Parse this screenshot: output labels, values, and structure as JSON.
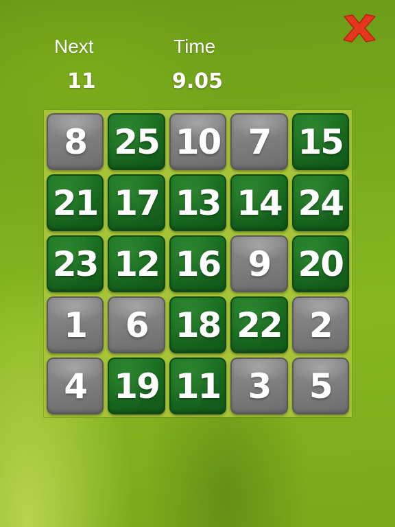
{
  "header": {
    "next_label": "Next",
    "next_value": "11",
    "time_label": "Time",
    "time_value": "9.05"
  },
  "close_icon": "close-x-icon",
  "colors": {
    "close": "#e2371d",
    "tile_green": "#1a6d20",
    "tile_gray": "#7d7d7d",
    "board_bg": "#a7c337"
  },
  "grid": {
    "rows": 5,
    "cols": 5,
    "tiles": [
      {
        "n": "8",
        "color": "gray"
      },
      {
        "n": "25",
        "color": "green"
      },
      {
        "n": "10",
        "color": "gray"
      },
      {
        "n": "7",
        "color": "gray"
      },
      {
        "n": "15",
        "color": "green"
      },
      {
        "n": "21",
        "color": "green"
      },
      {
        "n": "17",
        "color": "green"
      },
      {
        "n": "13",
        "color": "green"
      },
      {
        "n": "14",
        "color": "green"
      },
      {
        "n": "24",
        "color": "green"
      },
      {
        "n": "23",
        "color": "green"
      },
      {
        "n": "12",
        "color": "green"
      },
      {
        "n": "16",
        "color": "green"
      },
      {
        "n": "9",
        "color": "gray"
      },
      {
        "n": "20",
        "color": "green"
      },
      {
        "n": "1",
        "color": "gray"
      },
      {
        "n": "6",
        "color": "gray"
      },
      {
        "n": "18",
        "color": "green"
      },
      {
        "n": "22",
        "color": "green"
      },
      {
        "n": "2",
        "color": "gray"
      },
      {
        "n": "4",
        "color": "gray"
      },
      {
        "n": "19",
        "color": "green"
      },
      {
        "n": "11",
        "color": "green"
      },
      {
        "n": "3",
        "color": "gray"
      },
      {
        "n": "5",
        "color": "gray"
      }
    ]
  }
}
